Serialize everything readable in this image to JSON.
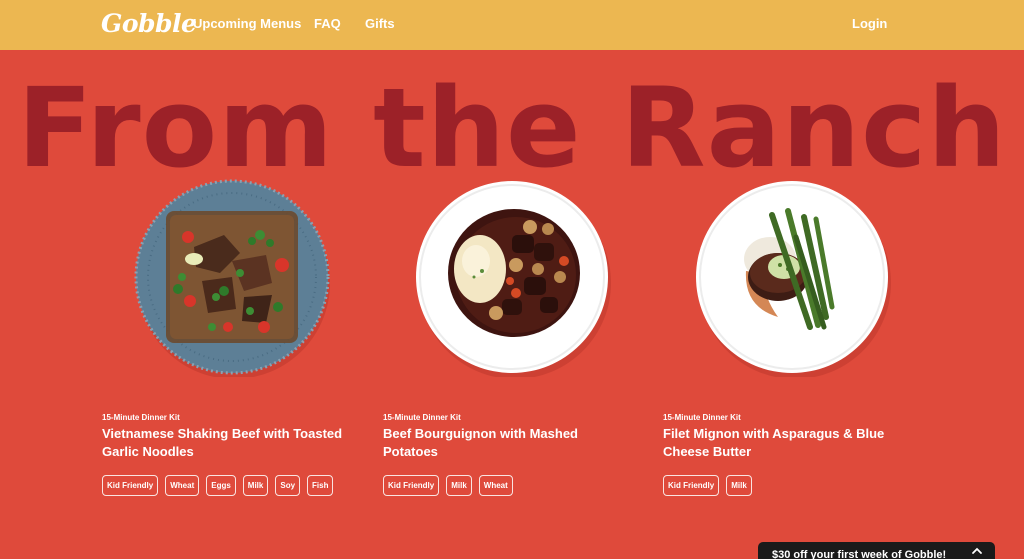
{
  "header": {
    "logo": "Gobble",
    "nav": [
      "Upcoming Menus",
      "FAQ",
      "Gifts"
    ],
    "login": "Login",
    "bg_color": "#ecb751"
  },
  "hero": {
    "title": "From the Ranch",
    "bg_color": "#df4a3b",
    "title_color": "#9c2128"
  },
  "menu_items": [
    {
      "kicker": "15-Minute Dinner Kit",
      "title": "Vietnamese Shaking Beef with Toasted Garlic Noodles",
      "tags": [
        "Kid Friendly",
        "Wheat",
        "Eggs",
        "Milk",
        "Soy",
        "Fish"
      ]
    },
    {
      "kicker": "15-Minute Dinner Kit",
      "title": "Beef Bourguignon with Mashed Potatoes",
      "tags": [
        "Kid Friendly",
        "Milk",
        "Wheat"
      ]
    },
    {
      "kicker": "15-Minute Dinner Kit",
      "title": "Filet Mignon with Asparagus & Blue Cheese Butter",
      "tags": [
        "Kid Friendly",
        "Milk"
      ]
    }
  ],
  "promo": {
    "text": "$30 off your first week of Gobble!",
    "icon": "chevron-up-icon"
  }
}
